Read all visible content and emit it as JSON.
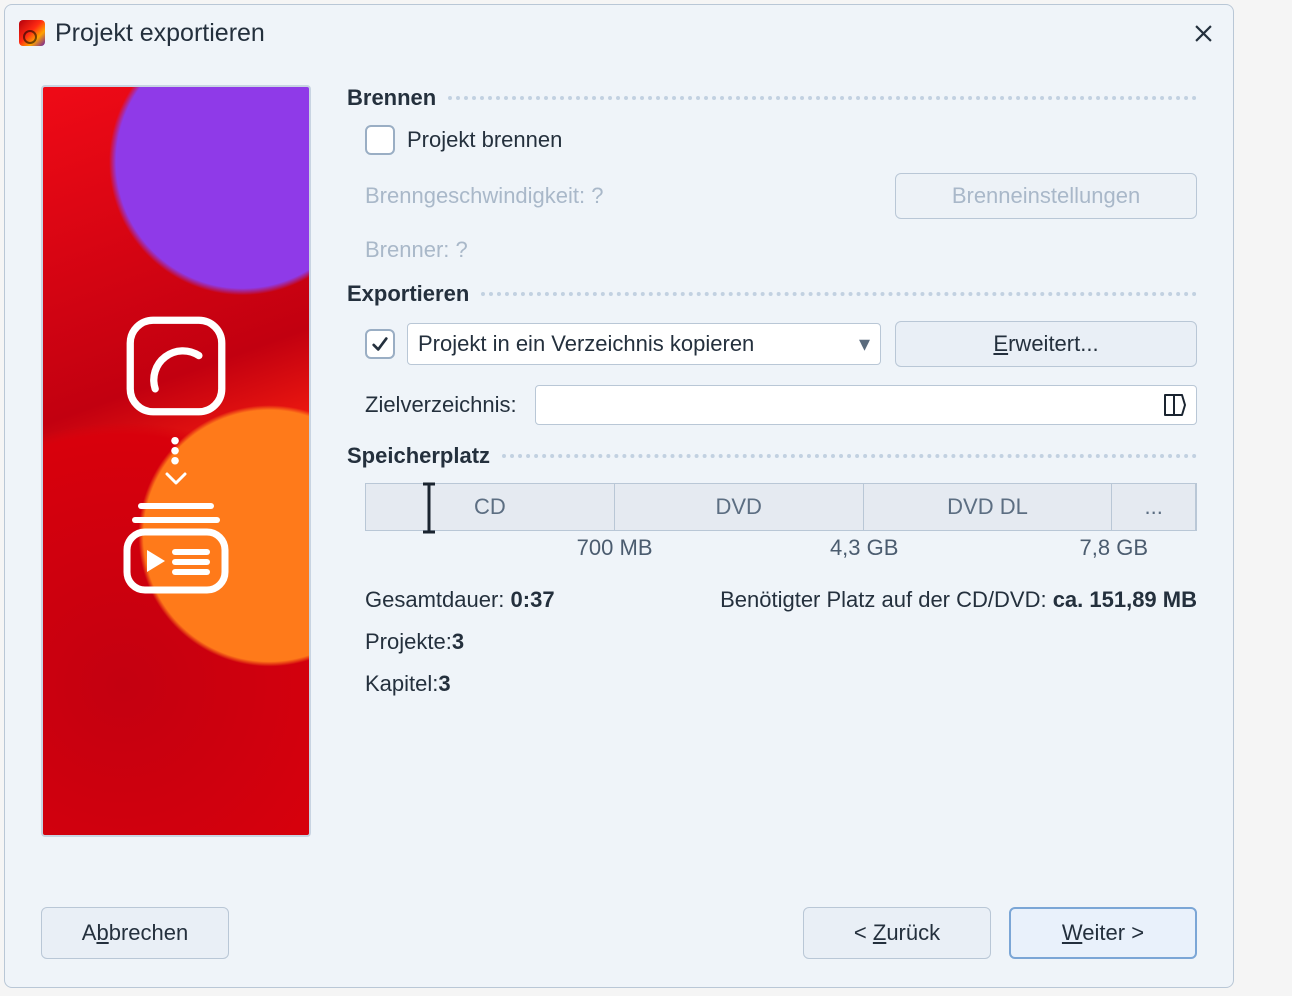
{
  "title": "Projekt exportieren",
  "sections": {
    "burn": {
      "header": "Brennen",
      "project_burn_label": "Projekt brennen",
      "speed_label": "Brenngeschwindigkeit: ?",
      "burner_label": "Brenner: ?",
      "settings_button": "Brenneinstellungen"
    },
    "export": {
      "header": "Exportieren",
      "combo_value": "Projekt in ein Verzeichnis kopieren",
      "advanced_button_prefix": "E",
      "advanced_button_rest": "rweitert...",
      "target_dir_label": "Zielverzeichnis:"
    },
    "storage": {
      "header": "Speicherplatz",
      "segments": {
        "cd": "CD",
        "dvd": "DVD",
        "dvddl": "DVD DL",
        "more": "..."
      },
      "labels": {
        "l700": "700 MB",
        "l43": "4,3 GB",
        "l78": "7,8 GB"
      },
      "duration_label": "Gesamtdauer: ",
      "duration_value": "0:37",
      "needed_label": "Benötigter Platz auf der CD/DVD: ",
      "needed_value": "ca. 151,89 MB",
      "projects_label": "Projekte: ",
      "projects_value": "3",
      "chapters_label": "Kapitel: ",
      "chapters_value": "3"
    }
  },
  "footer": {
    "cancel_prefix": "A",
    "cancel_u": "b",
    "cancel_rest": "brechen",
    "back_prefix": "< ",
    "back_u": "Z",
    "back_rest": "urück",
    "next_u": "W",
    "next_rest": "eiter >"
  }
}
